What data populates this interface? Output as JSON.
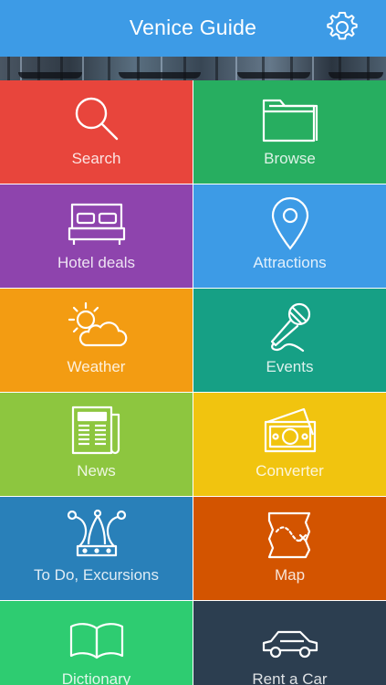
{
  "header": {
    "title": "Venice Guide",
    "settings_icon": "gear-icon",
    "background": "#3d9be6"
  },
  "banner": {
    "image": "venice-gondolas-photo"
  },
  "tiles": [
    {
      "label": "Search",
      "icon": "magnifier-icon",
      "color": "#e8453c"
    },
    {
      "label": "Browse",
      "icon": "folder-icon",
      "color": "#27ae60"
    },
    {
      "label": "Hotel deals",
      "icon": "bed-icon",
      "color": "#8e44ad"
    },
    {
      "label": "Attractions",
      "icon": "map-pin-icon",
      "color": "#3d9be6"
    },
    {
      "label": "Weather",
      "icon": "sun-cloud-icon",
      "color": "#f39c12"
    },
    {
      "label": "Events",
      "icon": "microphone-icon",
      "color": "#16a085"
    },
    {
      "label": "News",
      "icon": "newspaper-icon",
      "color": "#8dc63f"
    },
    {
      "label": "Converter",
      "icon": "money-icon",
      "color": "#f1c40f"
    },
    {
      "label": "To Do, Excursions",
      "icon": "jester-hat-icon",
      "color": "#2980b9"
    },
    {
      "label": "Map",
      "icon": "treasure-map-icon",
      "color": "#d35400"
    },
    {
      "label": "Dictionary",
      "icon": "book-icon",
      "color": "#2ecc71"
    },
    {
      "label": "Rent a Car",
      "icon": "car-icon",
      "color": "#2c3e50"
    }
  ]
}
